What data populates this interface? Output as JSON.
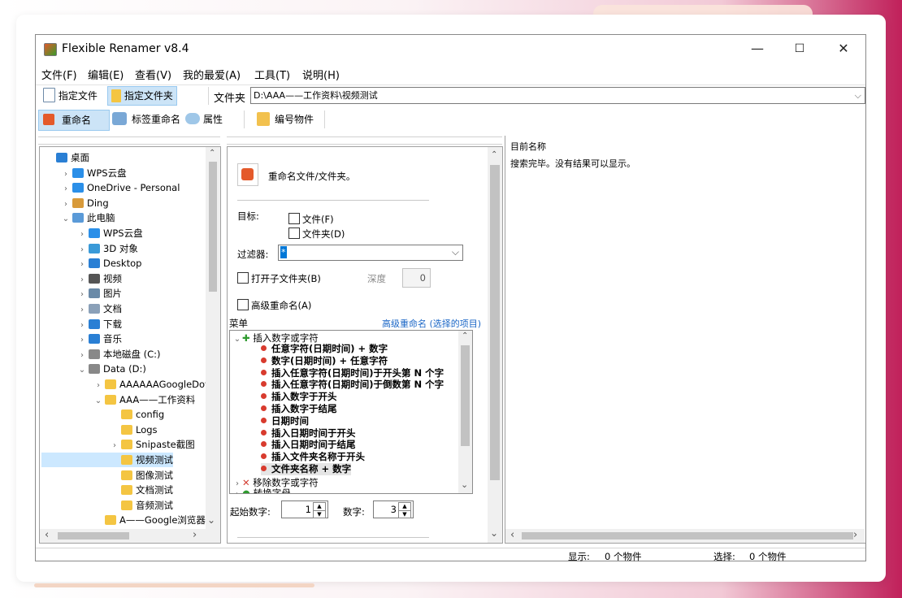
{
  "window": {
    "title": "Flexible Renamer v8.4",
    "min": "—",
    "max": "☐",
    "close": "✕"
  },
  "menu": [
    "文件(F)",
    "编辑(E)",
    "查看(V)",
    "我的最爱(A)",
    "工具(T)",
    "说明(H)"
  ],
  "toolbar1": {
    "specify_file": "指定文件",
    "specify_folder": "指定文件夹",
    "folder_label": "文件夹",
    "folder_path": "D:\\AAA——工作资料\\视频测试"
  },
  "toolbar2": {
    "rename": "重命名",
    "tag_rename": "标签重命名",
    "properties": "属性",
    "number_items": "编号物件"
  },
  "tree": [
    {
      "label": "桌面",
      "icon": "desktop-icon",
      "indent": 0,
      "chev": ""
    },
    {
      "label": "WPS云盘",
      "icon": "cloud-icon",
      "indent": 1,
      "chev": "›"
    },
    {
      "label": "OneDrive - Personal",
      "icon": "cloud-icon",
      "indent": 1,
      "chev": "›"
    },
    {
      "label": "Ding",
      "icon": "user-icon",
      "indent": 1,
      "chev": "›"
    },
    {
      "label": "此电脑",
      "icon": "pc-icon",
      "indent": 1,
      "chev": "⌄"
    },
    {
      "label": "WPS云盘",
      "icon": "cloud-icon",
      "indent": 2,
      "chev": "›"
    },
    {
      "label": "3D 对象",
      "icon": "cube-icon",
      "indent": 2,
      "chev": "›"
    },
    {
      "label": "Desktop",
      "icon": "desktop-icon",
      "indent": 2,
      "chev": "›"
    },
    {
      "label": "视频",
      "icon": "film-icon",
      "indent": 2,
      "chev": "›"
    },
    {
      "label": "图片",
      "icon": "picture-icon",
      "indent": 2,
      "chev": "›"
    },
    {
      "label": "文档",
      "icon": "document-icon",
      "indent": 2,
      "chev": "›"
    },
    {
      "label": "下载",
      "icon": "download-icon",
      "indent": 2,
      "chev": "›"
    },
    {
      "label": "音乐",
      "icon": "music-icon",
      "indent": 2,
      "chev": "›"
    },
    {
      "label": "本地磁盘 (C:)",
      "icon": "drive-icon",
      "indent": 2,
      "chev": "›"
    },
    {
      "label": "Data (D:)",
      "icon": "drive-icon",
      "indent": 2,
      "chev": "⌄"
    },
    {
      "label": "AAAAAAGoogleDown",
      "icon": "folder-icon",
      "indent": 3,
      "chev": "›"
    },
    {
      "label": "AAA——工作资料",
      "icon": "folder-icon",
      "indent": 3,
      "chev": "⌄"
    },
    {
      "label": "config",
      "icon": "folder-icon",
      "indent": 4,
      "chev": ""
    },
    {
      "label": "Logs",
      "icon": "folder-icon",
      "indent": 4,
      "chev": ""
    },
    {
      "label": "Snipaste截图",
      "icon": "folder-icon",
      "indent": 4,
      "chev": "›"
    },
    {
      "label": "视频测试",
      "icon": "folder-icon",
      "indent": 4,
      "chev": "",
      "selected": true
    },
    {
      "label": "图像测试",
      "icon": "folder-icon",
      "indent": 4,
      "chev": ""
    },
    {
      "label": "文档测试",
      "icon": "folder-icon",
      "indent": 4,
      "chev": ""
    },
    {
      "label": "音频测试",
      "icon": "folder-icon",
      "indent": 4,
      "chev": ""
    },
    {
      "label": "A——Google浏览器下载",
      "icon": "folder-icon",
      "indent": 3,
      "chev": ""
    }
  ],
  "rename_panel": {
    "heading": "重命名文件/文件夹。",
    "target_label": "目标:",
    "file_opt": "文件(F)",
    "folder_opt": "文件夹(D)",
    "filter_label": "过滤器:",
    "filter_value": "*",
    "open_subfolder": "打开子文件夹(B)",
    "depth_label": "深度",
    "depth_value": "0",
    "advanced": "高级重命名(A)",
    "menu_label": "菜单",
    "advanced_link": "高级重命名 (选择的项目)",
    "start_label": "起始数字:",
    "start_value": "1",
    "digits_label": "数字:",
    "digits_value": "3"
  },
  "menu_tree": {
    "group1": "插入数字或字符",
    "items": [
      "任意字符(日期时间) + 数字",
      "数字(日期时间) + 任意字符",
      "插入任意字符(日期时间)于开头第 N 个字",
      "插入任意字符(日期时间)于倒数第 N 个字",
      "插入数字于开头",
      "插入数字于结尾",
      "日期时间",
      "插入日期时间于开头",
      "插入日期时间于结尾",
      "插入文件夹名称于开头",
      "文件夹名称 + 数字"
    ],
    "group2": "移除数字或字符",
    "group3": "转换字母"
  },
  "results": {
    "header": "目前名称",
    "message": "搜索完毕。没有结果可以显示。"
  },
  "status": {
    "shown_label": "显示:",
    "shown_value": "0 个物件",
    "selected_label": "选择:",
    "selected_value": "0 个物件"
  }
}
